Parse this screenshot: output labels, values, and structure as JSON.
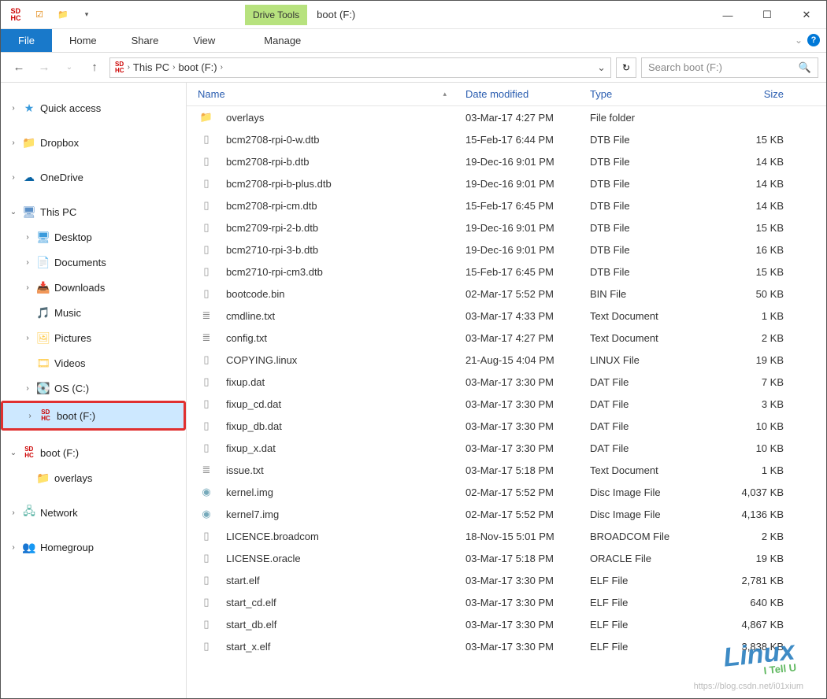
{
  "window": {
    "title": "boot (F:)",
    "drive_tools_label": "Drive Tools"
  },
  "ribbon": {
    "file": "File",
    "home": "Home",
    "share": "Share",
    "view": "View",
    "manage": "Manage"
  },
  "address": {
    "seg1": "This PC",
    "seg2": "boot (F:)"
  },
  "search": {
    "placeholder": "Search boot (F:)"
  },
  "columns": {
    "name": "Name",
    "date": "Date modified",
    "type": "Type",
    "size": "Size"
  },
  "nav": {
    "quick_access": "Quick access",
    "dropbox": "Dropbox",
    "onedrive": "OneDrive",
    "this_pc": "This PC",
    "desktop": "Desktop",
    "documents": "Documents",
    "downloads": "Downloads",
    "music": "Music",
    "pictures": "Pictures",
    "videos": "Videos",
    "os_c": "OS (C:)",
    "boot_f": "boot (F:)",
    "boot_f2": "boot (F:)",
    "overlays": "overlays",
    "network": "Network",
    "homegroup": "Homegroup"
  },
  "files": [
    {
      "icon": "folder",
      "name": "overlays",
      "date": "03-Mar-17 4:27 PM",
      "type": "File folder",
      "size": ""
    },
    {
      "icon": "file",
      "name": "bcm2708-rpi-0-w.dtb",
      "date": "15-Feb-17 6:44 PM",
      "type": "DTB File",
      "size": "15 KB"
    },
    {
      "icon": "file",
      "name": "bcm2708-rpi-b.dtb",
      "date": "19-Dec-16 9:01 PM",
      "type": "DTB File",
      "size": "14 KB"
    },
    {
      "icon": "file",
      "name": "bcm2708-rpi-b-plus.dtb",
      "date": "19-Dec-16 9:01 PM",
      "type": "DTB File",
      "size": "14 KB"
    },
    {
      "icon": "file",
      "name": "bcm2708-rpi-cm.dtb",
      "date": "15-Feb-17 6:45 PM",
      "type": "DTB File",
      "size": "14 KB"
    },
    {
      "icon": "file",
      "name": "bcm2709-rpi-2-b.dtb",
      "date": "19-Dec-16 9:01 PM",
      "type": "DTB File",
      "size": "15 KB"
    },
    {
      "icon": "file",
      "name": "bcm2710-rpi-3-b.dtb",
      "date": "19-Dec-16 9:01 PM",
      "type": "DTB File",
      "size": "16 KB"
    },
    {
      "icon": "file",
      "name": "bcm2710-rpi-cm3.dtb",
      "date": "15-Feb-17 6:45 PM",
      "type": "DTB File",
      "size": "15 KB"
    },
    {
      "icon": "file",
      "name": "bootcode.bin",
      "date": "02-Mar-17 5:52 PM",
      "type": "BIN File",
      "size": "50 KB"
    },
    {
      "icon": "text",
      "name": "cmdline.txt",
      "date": "03-Mar-17 4:33 PM",
      "type": "Text Document",
      "size": "1 KB"
    },
    {
      "icon": "text",
      "name": "config.txt",
      "date": "03-Mar-17 4:27 PM",
      "type": "Text Document",
      "size": "2 KB"
    },
    {
      "icon": "file",
      "name": "COPYING.linux",
      "date": "21-Aug-15 4:04 PM",
      "type": "LINUX File",
      "size": "19 KB"
    },
    {
      "icon": "file",
      "name": "fixup.dat",
      "date": "03-Mar-17 3:30 PM",
      "type": "DAT File",
      "size": "7 KB"
    },
    {
      "icon": "file",
      "name": "fixup_cd.dat",
      "date": "03-Mar-17 3:30 PM",
      "type": "DAT File",
      "size": "3 KB"
    },
    {
      "icon": "file",
      "name": "fixup_db.dat",
      "date": "03-Mar-17 3:30 PM",
      "type": "DAT File",
      "size": "10 KB"
    },
    {
      "icon": "file",
      "name": "fixup_x.dat",
      "date": "03-Mar-17 3:30 PM",
      "type": "DAT File",
      "size": "10 KB"
    },
    {
      "icon": "text",
      "name": "issue.txt",
      "date": "03-Mar-17 5:18 PM",
      "type": "Text Document",
      "size": "1 KB"
    },
    {
      "icon": "disc",
      "name": "kernel.img",
      "date": "02-Mar-17 5:52 PM",
      "type": "Disc Image File",
      "size": "4,037 KB"
    },
    {
      "icon": "disc",
      "name": "kernel7.img",
      "date": "02-Mar-17 5:52 PM",
      "type": "Disc Image File",
      "size": "4,136 KB"
    },
    {
      "icon": "file",
      "name": "LICENCE.broadcom",
      "date": "18-Nov-15 5:01 PM",
      "type": "BROADCOM File",
      "size": "2 KB"
    },
    {
      "icon": "file",
      "name": "LICENSE.oracle",
      "date": "03-Mar-17 5:18 PM",
      "type": "ORACLE File",
      "size": "19 KB"
    },
    {
      "icon": "file",
      "name": "start.elf",
      "date": "03-Mar-17 3:30 PM",
      "type": "ELF File",
      "size": "2,781 KB"
    },
    {
      "icon": "file",
      "name": "start_cd.elf",
      "date": "03-Mar-17 3:30 PM",
      "type": "ELF File",
      "size": "640 KB"
    },
    {
      "icon": "file",
      "name": "start_db.elf",
      "date": "03-Mar-17 3:30 PM",
      "type": "ELF File",
      "size": "4,867 KB"
    },
    {
      "icon": "file",
      "name": "start_x.elf",
      "date": "03-Mar-17 3:30 PM",
      "type": "ELF File",
      "size": "3,838 KB"
    }
  ],
  "watermark": {
    "main": "Linux",
    "sub": "I Tell U",
    "url": "https://blog.csdn.net/i01xium"
  }
}
